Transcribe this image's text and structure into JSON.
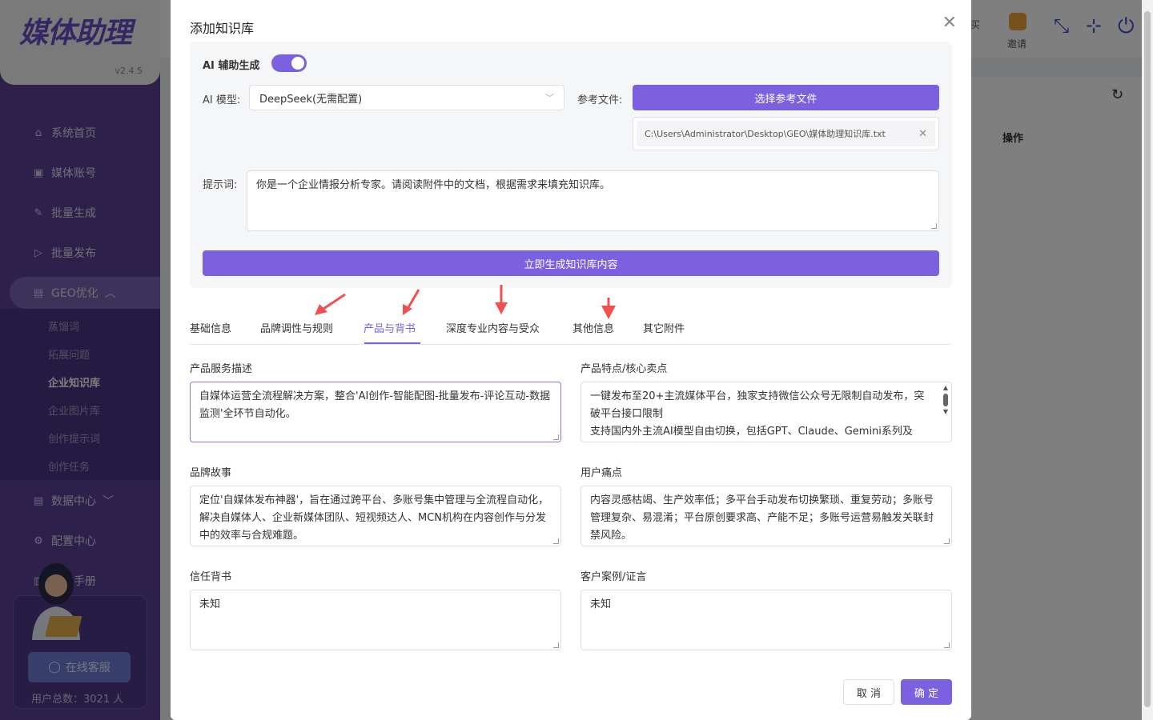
{
  "app": {
    "logo_text": "媒体助理",
    "version": "v2.4.5"
  },
  "sidebar": {
    "items": [
      {
        "label": "系统首页",
        "icon": "home-icon"
      },
      {
        "label": "媒体账号",
        "icon": "account-icon"
      },
      {
        "label": "批量生成",
        "icon": "edit-icon"
      },
      {
        "label": "批量发布",
        "icon": "send-icon"
      },
      {
        "label": "GEO优化",
        "icon": "doc-icon"
      },
      {
        "label": "数据中心",
        "icon": "doc-icon"
      },
      {
        "label": "配置中心",
        "icon": "gear-icon"
      },
      {
        "label": "操作手册",
        "icon": "book-icon"
      }
    ],
    "sub_items": [
      "蒸馏词",
      "拓展问题",
      "企业知识库",
      "企业图片库",
      "创作提示词",
      "创作任务"
    ],
    "support_button": "在线客服",
    "user_count": "用户总数：3021 人"
  },
  "topbar": {
    "buy_label": "购买",
    "invite_label": "邀请"
  },
  "background_table": {
    "action_header": "操作"
  },
  "dialog": {
    "title": "添加知识库",
    "ai_assist_label": "AI 辅助生成",
    "ai_assist_on": true,
    "model_label": "AI 模型:",
    "model_value": "DeepSeek(无需配置)",
    "ref_file_label": "参考文件:",
    "choose_file_button": "选择参考文件",
    "file_path": "C:\\Users\\Administrator\\Desktop\\GEO\\媒体助理知识库.txt",
    "prompt_label": "提示词:",
    "prompt_value": "你是一个企业情报分析专家。请阅读附件中的文档，根据需求来填充知识库。",
    "generate_button": "立即生成知识库内容",
    "tabs": [
      "基础信息",
      "品牌调性与规则",
      "产品与背书",
      "深度专业内容与受众",
      "其他信息",
      "其它附件"
    ],
    "active_tab": "产品与背书",
    "fields": {
      "product_desc": {
        "label": "产品服务描述",
        "value": "自媒体运营全流程解决方案，整合'AI创作-智能配图-批量发布-评论互动-数据监测'全环节自动化。"
      },
      "features": {
        "label": "产品特点/核心卖点",
        "value": "一键发布至20+主流媒体平台，独家支持微信公众号无限制自动发布，突破平台接口限制\n支持国内外主流AI模型自由切换，包括GPT、Claude、Gemini系列及"
      },
      "brand_story": {
        "label": "品牌故事",
        "value": "定位'自媒体发布神器'，旨在通过跨平台、多账号集中管理与全流程自动化，解决自媒体人、企业新媒体团队、短视频达人、MCN机构在内容创作与分发中的效率与合规难题。"
      },
      "pain_points": {
        "label": "用户痛点",
        "value": "内容灵感枯竭、生产效率低；多平台手动发布切换繁琐、重复劳动；多账号管理复杂、易混淆；平台原创要求高、产能不足；多账号运营易触发关联封禁风险。"
      },
      "endorsement": {
        "label": "信任背书",
        "value": "未知"
      },
      "cases": {
        "label": "客户案例/证言",
        "value": "未知"
      }
    },
    "cancel_button": "取 消",
    "ok_button": "确 定"
  }
}
